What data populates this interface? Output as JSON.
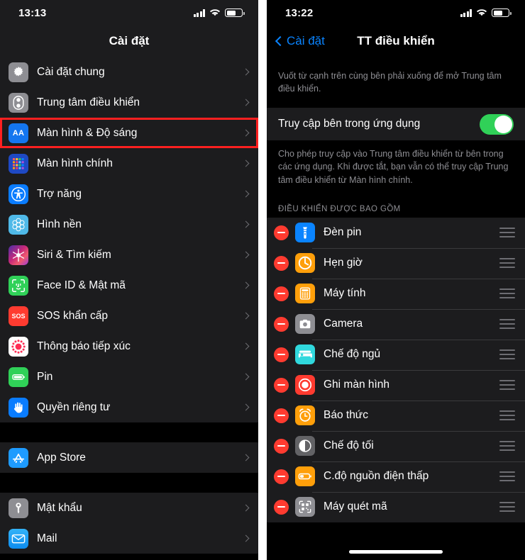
{
  "left_panel": {
    "status": {
      "time": "13:13",
      "signal_icon": "cellular-bars-icon",
      "wifi_icon": "wifi-icon",
      "battery_icon": "battery-icon"
    },
    "nav": {
      "title": "Cài đặt"
    },
    "groups": [
      {
        "items": [
          {
            "label": "Cài đặt chung",
            "icon": "gear-icon",
            "icon_class": "ic-gear",
            "highlighted": false
          },
          {
            "label": "Trung tâm điều khiển",
            "icon": "control-center-icon",
            "icon_class": "ic-cc",
            "highlighted": false
          },
          {
            "label": "Màn hình & Độ sáng",
            "icon": "display-brightness-icon",
            "icon_class": "ic-aa",
            "highlighted": true
          },
          {
            "label": "Màn hình chính",
            "icon": "home-screen-icon",
            "icon_class": "ic-home",
            "highlighted": false
          },
          {
            "label": "Trợ năng",
            "icon": "accessibility-icon",
            "icon_class": "ic-acc",
            "highlighted": false
          },
          {
            "label": "Hình nền",
            "icon": "wallpaper-icon",
            "icon_class": "ic-wall",
            "highlighted": false
          },
          {
            "label": "Siri & Tìm kiếm",
            "icon": "siri-icon",
            "icon_class": "ic-siri",
            "highlighted": false
          },
          {
            "label": "Face ID & Mật mã",
            "icon": "face-id-icon",
            "icon_class": "ic-face",
            "highlighted": false
          },
          {
            "label": "SOS khẩn cấp",
            "icon": "sos-icon",
            "icon_class": "ic-sos",
            "highlighted": false
          },
          {
            "label": "Thông báo tiếp xúc",
            "icon": "exposure-notification-icon",
            "icon_class": "ic-expo",
            "highlighted": false
          },
          {
            "label": "Pin",
            "icon": "battery-icon",
            "icon_class": "ic-batt",
            "highlighted": false
          },
          {
            "label": "Quyền riêng tư",
            "icon": "privacy-hand-icon",
            "icon_class": "ic-priv",
            "highlighted": false
          }
        ]
      },
      {
        "items": [
          {
            "label": "App Store",
            "icon": "app-store-icon",
            "icon_class": "ic-appstore",
            "highlighted": false
          }
        ]
      },
      {
        "items": [
          {
            "label": "Mật khẩu",
            "icon": "key-icon",
            "icon_class": "ic-key",
            "highlighted": false
          },
          {
            "label": "Mail",
            "icon": "mail-icon",
            "icon_class": "ic-mail",
            "highlighted": false
          }
        ]
      }
    ]
  },
  "right_panel": {
    "status": {
      "time": "13:22",
      "signal_icon": "cellular-bars-icon",
      "wifi_icon": "wifi-icon",
      "battery_icon": "battery-icon"
    },
    "nav": {
      "back_label": "Cài đặt",
      "title": "TT điều khiển"
    },
    "top_note": "Vuốt từ cạnh trên cùng bên phải xuống để mở Trung tâm điều khiển.",
    "toggle": {
      "label": "Truy cập bên trong ứng dụng",
      "state": "on",
      "color": "#30d158"
    },
    "description": "Cho phép truy cập vào Trung tâm điều khiển từ bên trong các ứng dụng. Khi được tắt, bạn vẫn có thể truy cập Trung tâm điều khiển từ Màn hình chính.",
    "section_header": "ĐIỀU KHIỂN ĐƯỢC BAO GỒM",
    "controls": [
      {
        "label": "Đèn pin",
        "icon": "flashlight-icon",
        "icon_class": "ic-flash"
      },
      {
        "label": "Hẹn giờ",
        "icon": "timer-icon",
        "icon_class": "ic-timer"
      },
      {
        "label": "Máy tính",
        "icon": "calculator-icon",
        "icon_class": "ic-calc"
      },
      {
        "label": "Camera",
        "icon": "camera-icon",
        "icon_class": "ic-cam"
      },
      {
        "label": "Chế độ ngủ",
        "icon": "sleep-bed-icon",
        "icon_class": "ic-sleep"
      },
      {
        "label": "Ghi màn hình",
        "icon": "screen-record-icon",
        "icon_class": "ic-rec"
      },
      {
        "label": "Báo thức",
        "icon": "alarm-clock-icon",
        "icon_class": "ic-alarm"
      },
      {
        "label": "Chế độ tối",
        "icon": "dark-mode-icon",
        "icon_class": "ic-dark"
      },
      {
        "label": "C.độ nguồn điện thấp",
        "icon": "low-power-icon",
        "icon_class": "ic-lowpower"
      },
      {
        "label": "Máy quét mã",
        "icon": "qr-scanner-icon",
        "icon_class": "ic-qr"
      }
    ]
  },
  "highlight": {
    "color": "#ff2020"
  }
}
